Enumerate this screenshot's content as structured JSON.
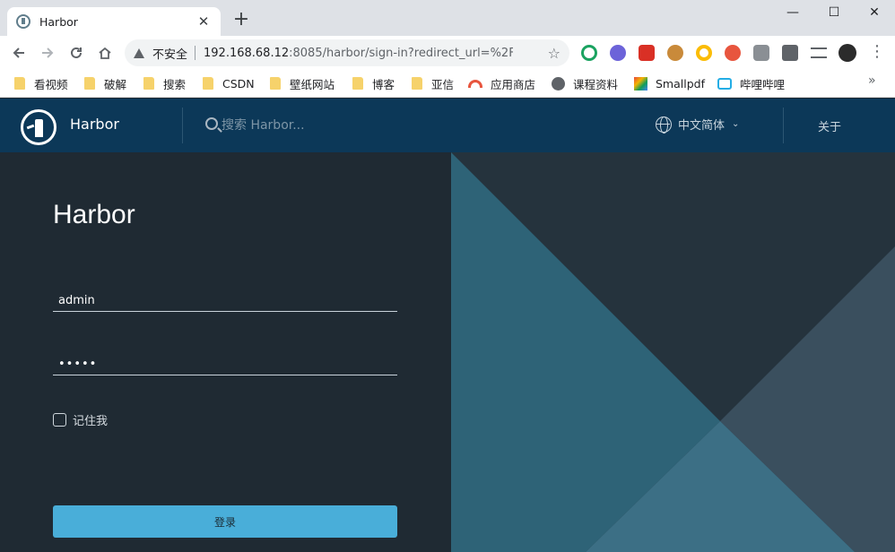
{
  "browser": {
    "tab_title": "Harbor",
    "tab_close": "✕",
    "new_tab": "+",
    "security_label": "不安全",
    "url_host": "192.168.68.12",
    "url_rest": ":8085/harbor/sign-in?redirect_url=%2Fhar...",
    "window_controls": {
      "minimize": "—",
      "maximize": "☐",
      "close": "✕"
    }
  },
  "bookmarks": [
    {
      "label": "看视频",
      "icon": "folder-icon"
    },
    {
      "label": "破解",
      "icon": "folder-icon"
    },
    {
      "label": "搜索",
      "icon": "folder-icon"
    },
    {
      "label": "CSDN",
      "icon": "folder-icon"
    },
    {
      "label": "壁纸网站",
      "icon": "folder-icon"
    },
    {
      "label": "博客",
      "icon": "folder-icon"
    },
    {
      "label": "亚信",
      "icon": "folder-icon"
    },
    {
      "label": "应用商店",
      "icon": "rainbow-icon"
    },
    {
      "label": "课程资料",
      "icon": "globe-icon"
    },
    {
      "label": "Smallpdf",
      "icon": "smallpdf-icon"
    },
    {
      "label": "哔哩哔哩",
      "icon": "bilibili-icon"
    }
  ],
  "app": {
    "name": "Harbor",
    "search_placeholder": "搜索 Harbor...",
    "language": "中文简体",
    "about": "关于"
  },
  "login": {
    "title": "Harbor",
    "username_value": "admin",
    "password_value": "•••••",
    "remember_label": "记住我",
    "submit_label": "登录"
  },
  "colors": {
    "header_bg": "#0c3858",
    "panel_bg": "#1f2a33",
    "button_bg": "#49aed9"
  }
}
